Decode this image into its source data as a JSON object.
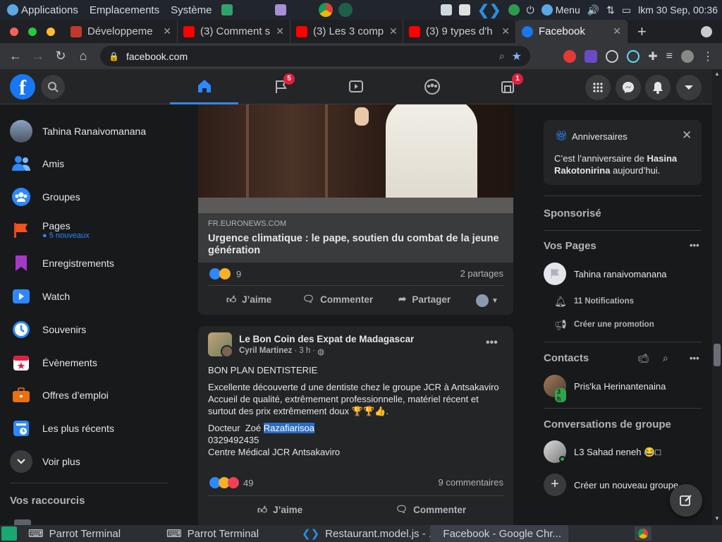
{
  "system_bar": {
    "menu_applications": "Applications",
    "menu_places": "Emplacements",
    "menu_system": "Système",
    "menu_label": "Menu",
    "clock": "lkm 30 Sep, 00:36"
  },
  "browser": {
    "tabs": [
      {
        "title": "Développeme",
        "favicon_color": "#c0392b"
      },
      {
        "title": "(3) Comment s",
        "favicon_color": "#ff0000"
      },
      {
        "title": "(3) Les 3 comp",
        "favicon_color": "#ff0000"
      },
      {
        "title": "(3) 9 types d'h",
        "favicon_color": "#ff0000"
      },
      {
        "title": "Facebook",
        "favicon_color": "#1877f2"
      }
    ],
    "new_tab": "+",
    "url": "facebook.com"
  },
  "facebook": {
    "logo": "f",
    "nav_badges": {
      "flag": "5",
      "gaming": "1"
    },
    "sidebar": {
      "user_name": "Tahina Ranaivomanana",
      "items": [
        {
          "label": "Amis",
          "icon": "friends-icon"
        },
        {
          "label": "Groupes",
          "icon": "groups-icon"
        },
        {
          "label": "Pages",
          "sub": "5 nouveaux",
          "icon": "pages-icon"
        },
        {
          "label": "Enregistrements",
          "icon": "bookmark-icon"
        },
        {
          "label": "Watch",
          "icon": "watch-icon"
        },
        {
          "label": "Souvenirs",
          "icon": "clock-icon"
        },
        {
          "label": "Évènements",
          "icon": "calendar-icon"
        },
        {
          "label": "Offres d’emploi",
          "icon": "briefcase-icon"
        },
        {
          "label": "Les plus récents",
          "icon": "recent-icon"
        },
        {
          "label": "Voir plus",
          "icon": "chevron-down-icon"
        }
      ],
      "shortcuts_title": "Vos raccourcis"
    },
    "post1": {
      "source": "FR.EURONEWS.COM",
      "headline": "Urgence climatique : le pape, soutien du combat de la jeune génération",
      "reaction_count": "9",
      "shares": "2 partages",
      "like_label": "J’aime",
      "comment_label": "Commenter",
      "share_label": "Partager"
    },
    "post2": {
      "group": "Le Bon Coin des Expat de Madagascar",
      "author": "Cyril Martinez",
      "time": "3 h",
      "line1": "BON PLAN DENTISTERIE",
      "line2": "Excellente découverte d une dentiste chez le groupe JCR à Antsakaviro",
      "line3": "Accueil de qualité, extrêmement professionnelle, matériel récent et surtout des prix extrêmement doux 🏆🏆👍.",
      "doctor_prefix": "Docteur  Zoé ",
      "doctor_highlight": "Razafiarisoa",
      "phone": "0329492435",
      "center": "Centre Médical JCR Antsakaviro",
      "reaction_count": "49",
      "comments": "9 commentaires",
      "like_label": "J’aime",
      "comment_label": "Commenter"
    },
    "right": {
      "birthday_title": "Anniversaires",
      "birthday_prefix": "C’est l’anniversaire de ",
      "birthday_name": "Hasina Rakotonirina",
      "birthday_suffix": " aujourd’hui.",
      "sponsored": "Sponsorisé",
      "your_pages": "Vos Pages",
      "page_name": "Tahina ranaivomanana",
      "notifications": "11 Notifications",
      "create_promo": "Créer une promotion",
      "contacts": "Contacts",
      "contact_name": "Pris'ka Herinantenaina",
      "contact_time": "3 h",
      "group_convos": "Conversations de groupe",
      "group_name": "L3 Sahad neneh 😂□",
      "new_group": "Créer un nouveau groupe"
    }
  },
  "taskbar": {
    "items": [
      "Parrot Terminal",
      "Parrot Terminal",
      "Restaurant.model.js - ...",
      "Facebook - Google Chr..."
    ]
  }
}
